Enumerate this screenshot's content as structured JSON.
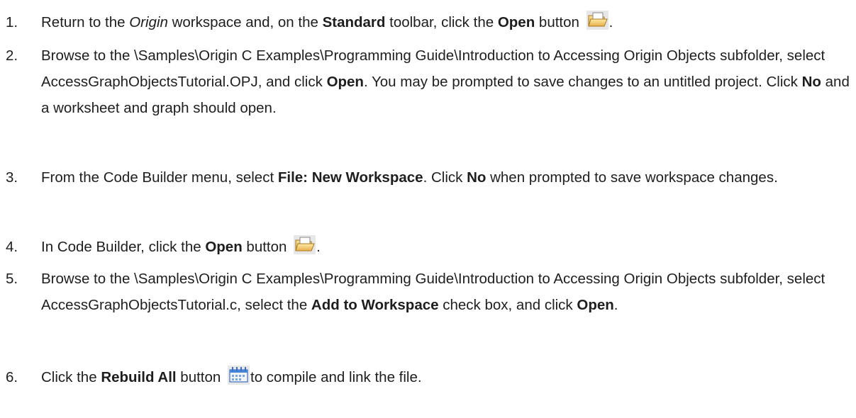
{
  "steps": [
    {
      "number": "1.",
      "parts": [
        {
          "text": "Return to the "
        },
        {
          "text": "Origin",
          "style": "i"
        },
        {
          "text": " workspace and, on the "
        },
        {
          "text": "Standard",
          "style": "b"
        },
        {
          "text": " toolbar, click the "
        },
        {
          "text": "Open",
          "style": "b"
        },
        {
          "text": " button "
        },
        {
          "icon": "folder-open-icon"
        },
        {
          "text": "."
        }
      ]
    },
    {
      "number": "2.",
      "parts": [
        {
          "text": "Browse to the \\Samples\\Origin C Examples\\Programming Guide\\Introduction to Accessing Origin Objects subfolder, select AccessGraphObjectsTutorial.OPJ, and click "
        },
        {
          "text": "Open",
          "style": "b"
        },
        {
          "text": ". You may be prompted to save changes to an untitled project. Click "
        },
        {
          "text": "No",
          "style": "b"
        },
        {
          "text": " and a worksheet and graph should open."
        }
      ]
    },
    {
      "number": "3.",
      "parts": [
        {
          "text": "From the Code Builder menu, select "
        },
        {
          "text": "File: New Workspace",
          "style": "b"
        },
        {
          "text": ". Click "
        },
        {
          "text": "No",
          "style": "b"
        },
        {
          "text": " when prompted to save workspace changes."
        }
      ]
    },
    {
      "number": "4.",
      "parts": [
        {
          "text": "In Code Builder, click the "
        },
        {
          "text": "Open",
          "style": "b"
        },
        {
          "text": " button "
        },
        {
          "icon": "folder-open-icon"
        },
        {
          "text": "."
        }
      ]
    },
    {
      "number": "5.",
      "parts": [
        {
          "text": "Browse to the \\Samples\\Origin C Examples\\Programming Guide\\Introduction to Accessing Origin Objects subfolder, select AccessGraphObjectsTutorial.c, select the "
        },
        {
          "text": "Add to Workspace",
          "style": "b"
        },
        {
          "text": " check box, and click "
        },
        {
          "text": "Open",
          "style": "b"
        },
        {
          "text": "."
        }
      ]
    },
    {
      "number": "6.",
      "parts": [
        {
          "text": "Click the "
        },
        {
          "text": "Rebuild All",
          "style": "b"
        },
        {
          "text": " button "
        },
        {
          "icon": "rebuild-all-icon"
        },
        {
          "text": "to compile and link the file."
        }
      ]
    }
  ]
}
